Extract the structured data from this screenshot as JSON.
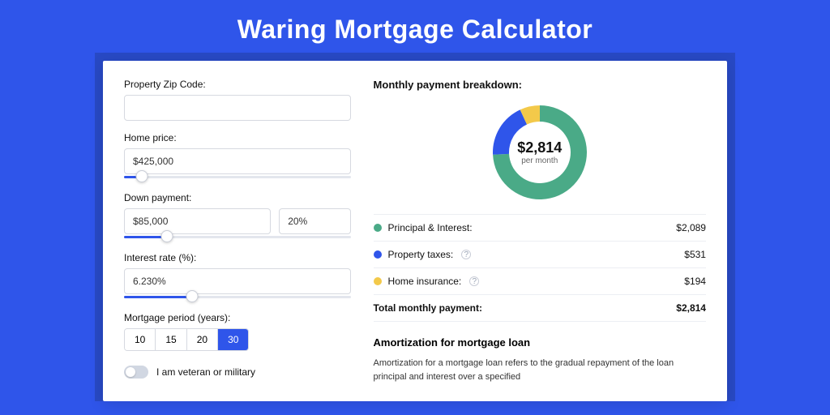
{
  "title": "Waring Mortgage Calculator",
  "form": {
    "zip_label": "Property Zip Code:",
    "zip_value": "",
    "home_price_label": "Home price:",
    "home_price_value": "$425,000",
    "home_price_slider_pct": 8,
    "down_payment_label": "Down payment:",
    "down_payment_value": "$85,000",
    "down_payment_pct": "20%",
    "down_payment_slider_pct": 19,
    "interest_label": "Interest rate (%):",
    "interest_value": "6.230%",
    "interest_slider_pct": 30,
    "period_label": "Mortgage period (years):",
    "periods": [
      "10",
      "15",
      "20",
      "30"
    ],
    "period_selected": "30",
    "veteran_label": "I am veteran or military"
  },
  "breakdown": {
    "title": "Monthly payment breakdown:",
    "center_value": "$2,814",
    "center_sub": "per month",
    "items": [
      {
        "label": "Principal & Interest:",
        "value": "$2,089",
        "numeric": 2089,
        "color": "#4aaa87",
        "help": false
      },
      {
        "label": "Property taxes:",
        "value": "$531",
        "numeric": 531,
        "color": "#2f55ea",
        "help": true
      },
      {
        "label": "Home insurance:",
        "value": "$194",
        "numeric": 194,
        "color": "#f3c94a",
        "help": true
      }
    ],
    "total_label": "Total monthly payment:",
    "total_value": "$2,814"
  },
  "amortization": {
    "title": "Amortization for mortgage loan",
    "text": "Amortization for a mortgage loan refers to the gradual repayment of the loan principal and interest over a specified"
  },
  "chart_data": {
    "type": "pie",
    "title": "Monthly payment breakdown",
    "series": [
      {
        "name": "Principal & Interest",
        "value": 2089
      },
      {
        "name": "Property taxes",
        "value": 531
      },
      {
        "name": "Home insurance",
        "value": 194
      }
    ],
    "total": 2814,
    "center_label": "$2,814 per month"
  }
}
